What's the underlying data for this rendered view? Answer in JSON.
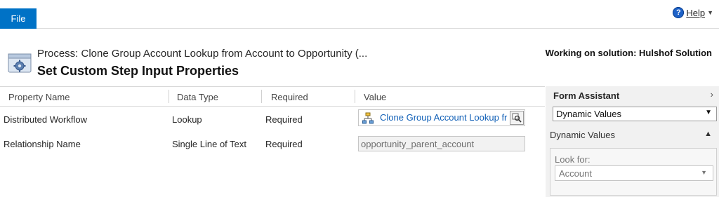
{
  "ribbon": {
    "file_tab": "File",
    "help_label": "Help"
  },
  "header": {
    "subtitle": "Process: Clone Group Account Lookup from Account to Opportunity (...",
    "title": "Set Custom Step Input Properties",
    "solution": "Working on solution: Hulshof Solution"
  },
  "grid": {
    "columns": [
      "Property Name",
      "Data Type",
      "Required",
      "Value"
    ],
    "rows": [
      {
        "property": "Distributed Workflow",
        "type": "Lookup",
        "required": "Required",
        "value": "Clone Group Account Lookup fr"
      },
      {
        "property": "Relationship Name",
        "type": "Single Line of Text",
        "required": "Required",
        "value": "opportunity_parent_account"
      }
    ]
  },
  "form_assistant": {
    "title": "Form Assistant",
    "selected": "Dynamic Values",
    "section": "Dynamic Values",
    "look_for_label": "Look for:",
    "look_for_value": "Account"
  },
  "colors": {
    "accent": "#0072c6",
    "link": "#1160b7",
    "panel": "#f1f1f1"
  }
}
